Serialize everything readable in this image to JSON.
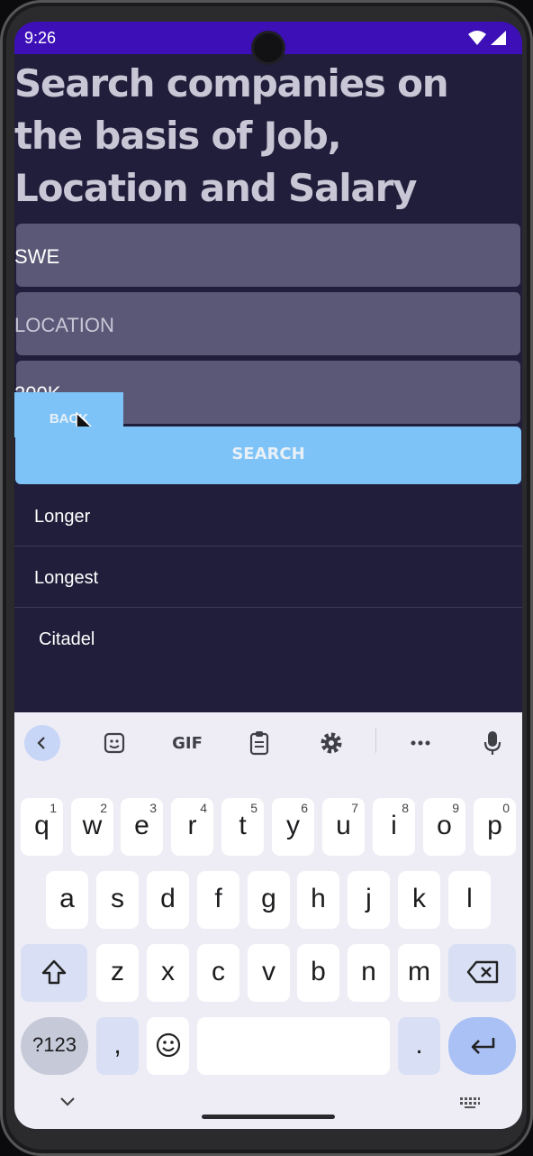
{
  "status_bar": {
    "time": "9:26",
    "icons": [
      "wifi-icon",
      "signal-icon"
    ]
  },
  "page": {
    "title": "Search companies on the basis of Job, Location and Salary",
    "fields": {
      "job": {
        "value": "SWE"
      },
      "location": {
        "placeholder": "LOCATION"
      },
      "salary": {
        "value": "200K"
      }
    },
    "back_label": "BACK",
    "search_label": "SEARCH",
    "results": [
      "Longer",
      "Longest",
      "Citadel"
    ]
  },
  "keyboard": {
    "toolbar": [
      "back-icon",
      "sticker-icon",
      "GIF",
      "clipboard-icon",
      "settings-icon",
      "more-icon",
      "mic-icon"
    ],
    "gif_label": "GIF",
    "row1": [
      "q",
      "w",
      "e",
      "r",
      "t",
      "y",
      "u",
      "i",
      "o",
      "p"
    ],
    "row1_hints": [
      "1",
      "2",
      "3",
      "4",
      "5",
      "6",
      "7",
      "8",
      "9",
      "0"
    ],
    "row2": [
      "a",
      "s",
      "d",
      "f",
      "g",
      "h",
      "j",
      "k",
      "l"
    ],
    "row3": [
      "z",
      "x",
      "c",
      "v",
      "b",
      "n",
      "m"
    ],
    "symbols_label": "?123",
    "comma": ",",
    "period": "."
  },
  "colors": {
    "status_bar": "#3c0fb7",
    "background": "#201e3a",
    "field": "#5b5877",
    "button": "#7ec3f7",
    "keyboard": "#eeedf5"
  }
}
